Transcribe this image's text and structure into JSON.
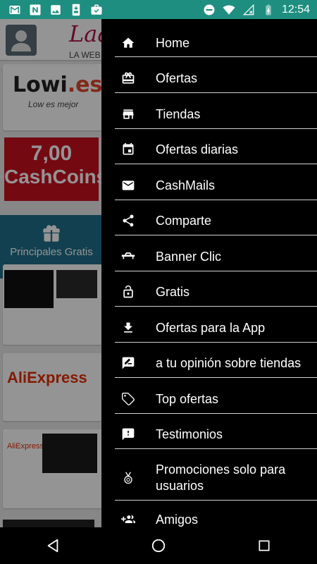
{
  "status_bar": {
    "time": "12:54",
    "left_icons": [
      "gmail-icon",
      "n-app-icon",
      "image-icon",
      "phone-app-icon",
      "briefcase-check-icon"
    ],
    "right_icons": [
      "do-not-disturb-icon",
      "wifi-icon",
      "no-signal-icon",
      "battery-charging-icon"
    ],
    "bg_color": "#1e8e80"
  },
  "app_background": {
    "logo_text": "Laa",
    "logo_sub": "LA WEB",
    "lowi_logo": "Lowi",
    "lowi_domain": ".es",
    "lowi_tagline": "Low es mejor",
    "cashcoins_amount": "7,00",
    "cashcoins_label": "CashCoins",
    "gratis_tile_label": "Principales Gratis",
    "aliexpress_1": "AliExpress",
    "aliexpress_2": "AliExpress"
  },
  "drawer": {
    "items": [
      {
        "label": "Home",
        "icon": "home-icon"
      },
      {
        "label": "Ofertas",
        "icon": "card-giftcard-icon"
      },
      {
        "label": "Tiendas",
        "icon": "store-icon"
      },
      {
        "label": "Ofertas diarias",
        "icon": "calendar-icon"
      },
      {
        "label": "CashMails",
        "icon": "email-icon"
      },
      {
        "label": "Comparte",
        "icon": "share-icon"
      },
      {
        "label": "Banner Clic",
        "icon": "table-icon"
      },
      {
        "label": "Gratis",
        "icon": "lock-open-icon"
      },
      {
        "label": "Ofertas para la App",
        "icon": "download-icon"
      },
      {
        "label": "a tu opinión sobre tiendas",
        "icon": "rate-review-icon"
      },
      {
        "label": "Top ofertas",
        "icon": "tag-icon"
      },
      {
        "label": "Testimonios",
        "icon": "feedback-icon"
      },
      {
        "label": "Promociones solo para usuarios",
        "icon": "medal-icon"
      },
      {
        "label": "Amigos",
        "icon": "group-add-icon"
      }
    ]
  },
  "navbar": {
    "buttons": [
      "back-icon",
      "home-circle-icon",
      "recents-icon"
    ]
  }
}
